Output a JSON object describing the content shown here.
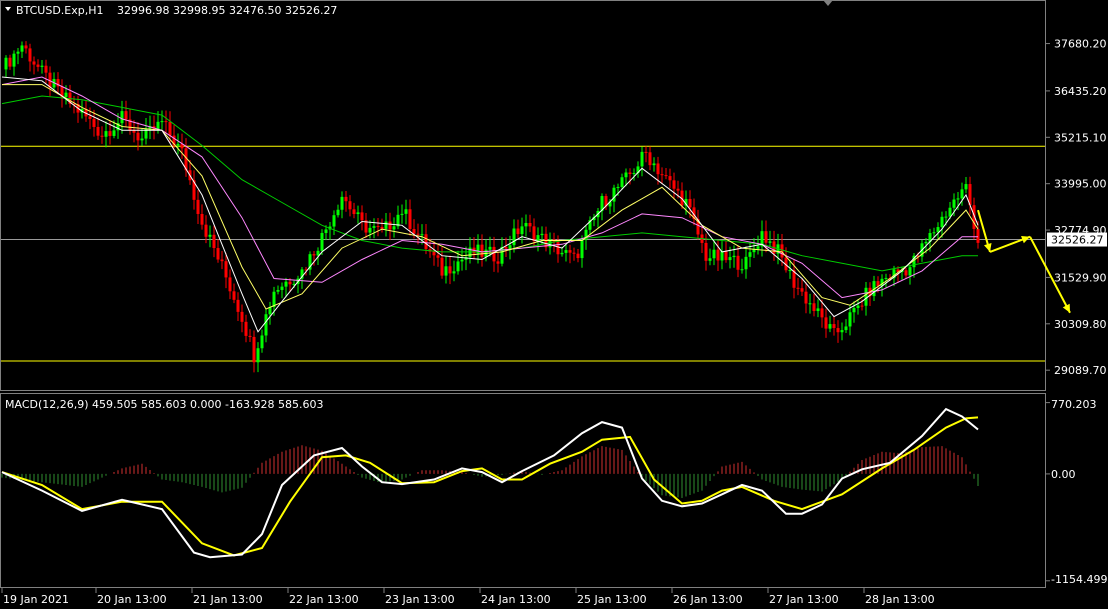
{
  "header": {
    "symbol": "BTCUSD.Exp,H1",
    "ohlc": "32996.98 32998.95 32476.50 32526.27"
  },
  "macd_header": {
    "label": "MACD(12,26,9) 459.505 585.603 0.000 -163.928 585.603"
  },
  "colors": {
    "background": "#000000",
    "bull": "#00ff00",
    "bear": "#ff0000",
    "level_line": "#ffff00",
    "ma_fast": "#ffffff",
    "ma_mid": "#ffff66",
    "ma_slow": "#ff88ff",
    "ma_long": "#00cc00",
    "macd_line": "#ffffff",
    "signal_line": "#ffff00",
    "arrow": "#ffff00"
  },
  "chart_data": [
    {
      "type": "candlestick",
      "symbol": "BTCUSD.Exp",
      "timeframe": "H1",
      "ylim": [
        28700,
        38300
      ],
      "yticks": [
        "37680.20",
        "36435.20",
        "35215.10",
        "33995.00",
        "32774.90",
        "31529.90",
        "30309.80",
        "29089.70"
      ],
      "current_price": "32526.27",
      "x_labels": [
        "19 Jan 2021",
        "20 Jan 13:00",
        "21 Jan 13:00",
        "22 Jan 13:00",
        "23 Jan 13:00",
        "24 Jan 13:00",
        "25 Jan 13:00",
        "26 Jan 13:00",
        "27 Jan 13:00",
        "28 Jan 13:00"
      ],
      "levels": [
        34980,
        29330
      ],
      "close_path": [
        [
          0,
          37000
        ],
        [
          5,
          37650
        ],
        [
          10,
          36900
        ],
        [
          15,
          36300
        ],
        [
          20,
          35850
        ],
        [
          25,
          35300
        ],
        [
          30,
          35700
        ],
        [
          35,
          35150
        ],
        [
          40,
          35600
        ],
        [
          45,
          34800
        ],
        [
          50,
          33000
        ],
        [
          55,
          31800
        ],
        [
          60,
          30500
        ],
        [
          63,
          29500
        ],
        [
          68,
          31200
        ],
        [
          75,
          31700
        ],
        [
          80,
          32600
        ],
        [
          85,
          33700
        ],
        [
          90,
          32900
        ],
        [
          95,
          32700
        ],
        [
          100,
          33300
        ],
        [
          105,
          32500
        ],
        [
          110,
          31700
        ],
        [
          118,
          32200
        ],
        [
          124,
          32100
        ],
        [
          130,
          32900
        ],
        [
          137,
          32400
        ],
        [
          143,
          32000
        ],
        [
          150,
          33500
        ],
        [
          156,
          34100
        ],
        [
          161,
          34800
        ],
        [
          166,
          34100
        ],
        [
          171,
          33500
        ],
        [
          176,
          32100
        ],
        [
          181,
          32000
        ],
        [
          186,
          31900
        ],
        [
          190,
          32700
        ],
        [
          194,
          32200
        ],
        [
          198,
          31400
        ],
        [
          203,
          30700
        ],
        [
          208,
          30000
        ],
        [
          213,
          30600
        ],
        [
          217,
          31200
        ],
        [
          222,
          31600
        ],
        [
          227,
          31800
        ],
        [
          232,
          32600
        ],
        [
          237,
          33400
        ],
        [
          241,
          33900
        ],
        [
          244,
          32500
        ]
      ],
      "ma_fast": [
        [
          0,
          36800
        ],
        [
          10,
          36700
        ],
        [
          20,
          35900
        ],
        [
          30,
          35400
        ],
        [
          40,
          35400
        ],
        [
          50,
          33700
        ],
        [
          60,
          31100
        ],
        [
          64,
          30100
        ],
        [
          70,
          30900
        ],
        [
          80,
          32200
        ],
        [
          90,
          33000
        ],
        [
          100,
          32900
        ],
        [
          110,
          32100
        ],
        [
          120,
          32000
        ],
        [
          130,
          32600
        ],
        [
          140,
          32300
        ],
        [
          150,
          33300
        ],
        [
          160,
          34400
        ],
        [
          170,
          33600
        ],
        [
          180,
          32200
        ],
        [
          190,
          32400
        ],
        [
          200,
          31500
        ],
        [
          208,
          30500
        ],
        [
          215,
          30900
        ],
        [
          225,
          31700
        ],
        [
          235,
          32800
        ],
        [
          241,
          33700
        ],
        [
          244,
          32900
        ]
      ],
      "ma_mid": [
        [
          0,
          36600
        ],
        [
          10,
          36600
        ],
        [
          20,
          36000
        ],
        [
          30,
          35500
        ],
        [
          40,
          35400
        ],
        [
          50,
          34200
        ],
        [
          60,
          31800
        ],
        [
          66,
          30700
        ],
        [
          75,
          31100
        ],
        [
          85,
          32300
        ],
        [
          95,
          32800
        ],
        [
          105,
          32600
        ],
        [
          115,
          32100
        ],
        [
          125,
          32200
        ],
        [
          135,
          32500
        ],
        [
          145,
          32500
        ],
        [
          155,
          33300
        ],
        [
          165,
          33900
        ],
        [
          175,
          32900
        ],
        [
          185,
          32300
        ],
        [
          195,
          32200
        ],
        [
          205,
          31000
        ],
        [
          212,
          30800
        ],
        [
          222,
          31500
        ],
        [
          232,
          32300
        ],
        [
          241,
          33300
        ],
        [
          244,
          32800
        ]
      ],
      "ma_slow": [
        [
          0,
          36600
        ],
        [
          10,
          36800
        ],
        [
          20,
          36300
        ],
        [
          30,
          35700
        ],
        [
          40,
          35400
        ],
        [
          50,
          34700
        ],
        [
          60,
          33100
        ],
        [
          68,
          31500
        ],
        [
          80,
          31400
        ],
        [
          90,
          32000
        ],
        [
          100,
          32500
        ],
        [
          110,
          32400
        ],
        [
          120,
          32200
        ],
        [
          130,
          32300
        ],
        [
          140,
          32400
        ],
        [
          150,
          32700
        ],
        [
          160,
          33200
        ],
        [
          170,
          33100
        ],
        [
          180,
          32600
        ],
        [
          190,
          32400
        ],
        [
          200,
          31900
        ],
        [
          210,
          31000
        ],
        [
          220,
          31200
        ],
        [
          230,
          31700
        ],
        [
          240,
          32600
        ],
        [
          244,
          32600
        ]
      ],
      "ma_long": [
        [
          0,
          36100
        ],
        [
          10,
          36300
        ],
        [
          20,
          36200
        ],
        [
          30,
          36000
        ],
        [
          40,
          35800
        ],
        [
          50,
          35000
        ],
        [
          60,
          34100
        ],
        [
          70,
          33500
        ],
        [
          80,
          32900
        ],
        [
          90,
          32500
        ],
        [
          100,
          32300
        ],
        [
          110,
          32200
        ],
        [
          120,
          32200
        ],
        [
          130,
          32300
        ],
        [
          140,
          32500
        ],
        [
          150,
          32600
        ],
        [
          160,
          32700
        ],
        [
          170,
          32600
        ],
        [
          180,
          32500
        ],
        [
          190,
          32400
        ],
        [
          200,
          32100
        ],
        [
          210,
          31900
        ],
        [
          220,
          31700
        ],
        [
          230,
          31900
        ],
        [
          240,
          32100
        ],
        [
          244,
          32100
        ]
      ],
      "projection": [
        [
          244,
          33300
        ],
        [
          247,
          32200
        ],
        [
          257,
          32600
        ],
        [
          267,
          30600
        ]
      ]
    },
    {
      "type": "macd",
      "ylim": [
        -1200,
        820
      ],
      "yticks": [
        "770.203",
        "0.00",
        "-1154.499"
      ],
      "histogram": [
        [
          0,
          -40
        ],
        [
          10,
          -90
        ],
        [
          20,
          -140
        ],
        [
          30,
          60
        ],
        [
          35,
          110
        ],
        [
          40,
          -60
        ],
        [
          45,
          -90
        ],
        [
          50,
          -140
        ],
        [
          55,
          -200
        ],
        [
          60,
          -150
        ],
        [
          65,
          120
        ],
        [
          70,
          240
        ],
        [
          75,
          310
        ],
        [
          80,
          250
        ],
        [
          85,
          110
        ],
        [
          90,
          -40
        ],
        [
          95,
          -100
        ],
        [
          100,
          -60
        ],
        [
          105,
          40
        ],
        [
          110,
          40
        ],
        [
          115,
          20
        ],
        [
          120,
          -30
        ],
        [
          125,
          -10
        ],
        [
          130,
          30
        ],
        [
          135,
          -10
        ],
        [
          140,
          40
        ],
        [
          145,
          190
        ],
        [
          150,
          300
        ],
        [
          155,
          260
        ],
        [
          160,
          -40
        ],
        [
          165,
          -230
        ],
        [
          170,
          -260
        ],
        [
          175,
          -180
        ],
        [
          180,
          80
        ],
        [
          185,
          130
        ],
        [
          190,
          -60
        ],
        [
          195,
          -140
        ],
        [
          200,
          -170
        ],
        [
          205,
          -190
        ],
        [
          210,
          -60
        ],
        [
          215,
          150
        ],
        [
          220,
          240
        ],
        [
          225,
          220
        ],
        [
          230,
          290
        ],
        [
          235,
          300
        ],
        [
          240,
          180
        ],
        [
          244,
          -130
        ]
      ],
      "macd_line": [
        [
          0,
          20
        ],
        [
          10,
          -180
        ],
        [
          20,
          -400
        ],
        [
          30,
          -280
        ],
        [
          40,
          -380
        ],
        [
          48,
          -850
        ],
        [
          52,
          -900
        ],
        [
          60,
          -870
        ],
        [
          65,
          -650
        ],
        [
          70,
          -120
        ],
        [
          78,
          200
        ],
        [
          85,
          280
        ],
        [
          90,
          80
        ],
        [
          95,
          -90
        ],
        [
          100,
          -110
        ],
        [
          108,
          -60
        ],
        [
          115,
          60
        ],
        [
          120,
          20
        ],
        [
          125,
          -90
        ],
        [
          130,
          30
        ],
        [
          138,
          200
        ],
        [
          145,
          440
        ],
        [
          150,
          560
        ],
        [
          155,
          500
        ],
        [
          160,
          -50
        ],
        [
          165,
          -290
        ],
        [
          170,
          -350
        ],
        [
          175,
          -320
        ],
        [
          180,
          -220
        ],
        [
          185,
          -120
        ],
        [
          190,
          -180
        ],
        [
          196,
          -430
        ],
        [
          200,
          -430
        ],
        [
          205,
          -330
        ],
        [
          210,
          -50
        ],
        [
          215,
          50
        ],
        [
          222,
          120
        ],
        [
          230,
          410
        ],
        [
          236,
          700
        ],
        [
          240,
          620
        ],
        [
          244,
          480
        ]
      ],
      "signal_line": [
        [
          0,
          20
        ],
        [
          10,
          -120
        ],
        [
          20,
          -380
        ],
        [
          30,
          -300
        ],
        [
          40,
          -300
        ],
        [
          50,
          -750
        ],
        [
          58,
          -880
        ],
        [
          65,
          -800
        ],
        [
          72,
          -300
        ],
        [
          80,
          180
        ],
        [
          86,
          200
        ],
        [
          92,
          120
        ],
        [
          100,
          -100
        ],
        [
          108,
          -90
        ],
        [
          115,
          30
        ],
        [
          120,
          60
        ],
        [
          125,
          -60
        ],
        [
          130,
          -60
        ],
        [
          137,
          110
        ],
        [
          145,
          240
        ],
        [
          150,
          370
        ],
        [
          157,
          400
        ],
        [
          163,
          -60
        ],
        [
          170,
          -320
        ],
        [
          175,
          -290
        ],
        [
          180,
          -180
        ],
        [
          185,
          -140
        ],
        [
          193,
          -290
        ],
        [
          200,
          -380
        ],
        [
          205,
          -300
        ],
        [
          210,
          -220
        ],
        [
          220,
          60
        ],
        [
          228,
          260
        ],
        [
          236,
          500
        ],
        [
          241,
          600
        ],
        [
          244,
          610
        ]
      ]
    }
  ]
}
